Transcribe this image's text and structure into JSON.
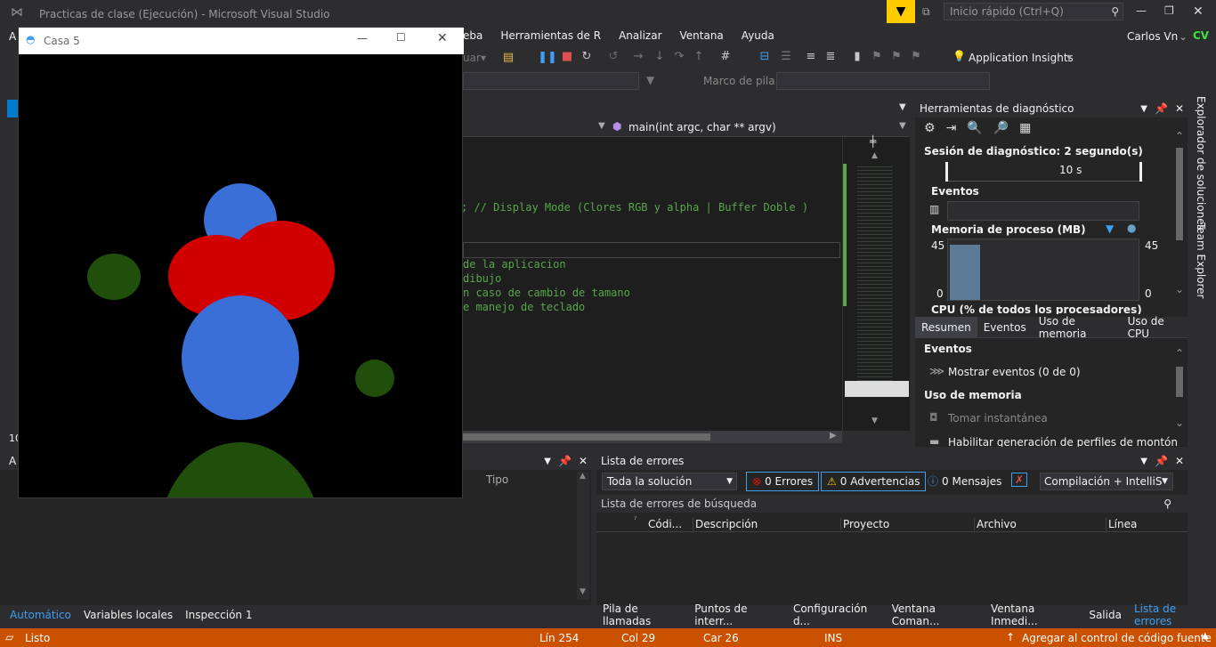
{
  "app": {
    "title": "Practicas de clase (Ejecución) - Microsoft Visual Studio",
    "quick_launch_placeholder": "Inicio rápido (Ctrl+Q)",
    "user": "Carlos Vn",
    "avatar_initials": "CV"
  },
  "menu": [
    "eba",
    "Herramientas de R",
    "Analizar",
    "Ventana",
    "Ayuda"
  ],
  "toolbar": {
    "continue_label": "uar",
    "app_insights": "Application Insights",
    "stack_frame_label": "Marco de pila:"
  },
  "editor": {
    "function_dropdown": "main(int argc, char ** argv)",
    "lines": [
      {
        "text": "; // Display Mode (Clores RGB y alpha | Buffer Doble )",
        "color": "#57a64a"
      },
      {
        "text": "de la aplicacion",
        "color": "#57a64a"
      },
      {
        "text": "dibujo",
        "color": "#57a64a"
      },
      {
        "text": "n caso de cambio de tamano",
        "color": "#57a64a"
      },
      {
        "text": "e manejo de teclado",
        "color": "#57a64a"
      }
    ]
  },
  "casa_window": {
    "title": "Casa 5",
    "circles_colors": {
      "blue": "#3a6fd8",
      "red": "#d00000",
      "green": "#1f4f0a"
    }
  },
  "diagnostics": {
    "title": "Herramientas de diagnóstico",
    "session": "Sesión de diagnóstico: 2 segundo(s)",
    "timeline_label": "10 s",
    "events_section": "Eventos",
    "memory_section": "Memoria de proceso (MB)",
    "memory_max_left": "45",
    "memory_max_right": "45",
    "memory_min_left": "0",
    "memory_min_right": "0",
    "cpu_section": "CPU (% de todos los procesadores)",
    "tabs": [
      "Resumen",
      "Eventos",
      "Uso de memoria",
      "Uso de CPU"
    ],
    "events_header": "Eventos",
    "show_events": "Mostrar eventos (0 de 0)",
    "memory_usage_header": "Uso de memoria",
    "take_snapshot": "Tomar instantánea",
    "heap_profiling": "Habilitar generación de perfiles de montón (a"
  },
  "side_tabs": [
    "Explorador de soluciones",
    "Team Explorer"
  ],
  "autos": {
    "col_type": "Tipo",
    "bottom_tabs": [
      "Automático",
      "Variables locales",
      "Inspección 1"
    ],
    "left_marker_a": "A",
    "left_marker_10": "10"
  },
  "errors": {
    "title": "Lista de errores",
    "scope": "Toda la solución",
    "errors_btn": "0 Errores",
    "warnings_btn": "0 Advertencias",
    "messages_btn": "0 Mensajes",
    "build_filter": "Compilación + IntelliSen",
    "search_placeholder": "Lista de errores de búsqueda",
    "columns": [
      "Códi...",
      "Descripción",
      "Proyecto",
      "Archivo",
      "Línea"
    ],
    "bottom_tabs": [
      "Pila de llamadas",
      "Puntos de interr...",
      "Configuración d...",
      "Ventana Coman...",
      "Ventana Inmedi...",
      "Salida",
      "Lista de errores"
    ]
  },
  "status": {
    "ready": "Listo",
    "line": "Lín 254",
    "col": "Col 29",
    "car": "Car 26",
    "ins": "INS",
    "source_control": "Agregar al control de código fuente"
  },
  "colors": {
    "accent": "#3e9ef0",
    "status": "#ca5100",
    "quicklaunch": "#ffcc00"
  }
}
